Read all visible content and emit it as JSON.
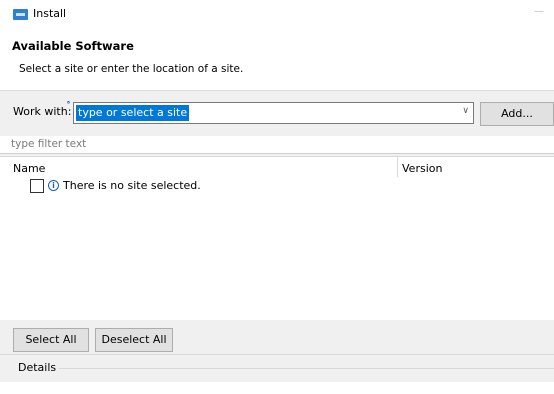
{
  "window": {
    "title": "Install",
    "app_icon": "eclipse-install-icon"
  },
  "page": {
    "title": "Available Software",
    "description": "Select a site or enter the location of a site."
  },
  "work_with": {
    "label": "Work with:",
    "value": "type or select a site",
    "add_label": "Add..."
  },
  "filter": {
    "placeholder": "type filter text"
  },
  "tree": {
    "columns": {
      "name": "Name",
      "version": "Version"
    },
    "message": "There is no site selected."
  },
  "buttons": {
    "select_all": "Select All",
    "deselect_all": "Deselect All"
  },
  "details": {
    "label": "Details"
  }
}
